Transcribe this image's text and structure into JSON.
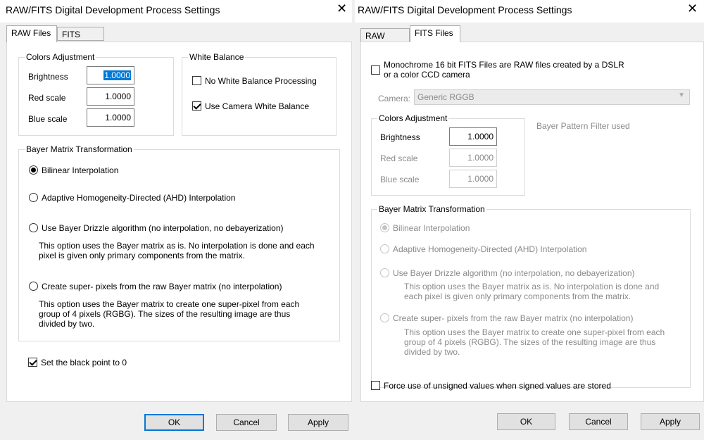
{
  "dialog_title": "RAW/FITS Digital Development Process Settings",
  "close_glyph": "✕",
  "tabs": {
    "raw": "RAW Files",
    "fits": "FITS Files"
  },
  "raw_tab": {
    "colors_adjustment": {
      "title": "Colors Adjustment",
      "brightness_label": "Brightness",
      "brightness_value": "1.0000",
      "red_label": "Red scale",
      "red_value": "1.0000",
      "blue_label": "Blue scale",
      "blue_value": "1.0000"
    },
    "white_balance": {
      "title": "White Balance",
      "no_wb": "No White Balance Processing",
      "no_wb_checked": false,
      "camera_wb": "Use Camera White Balance",
      "camera_wb_checked": true
    },
    "bayer": {
      "title": "Bayer Matrix Transformation",
      "bilinear": "Bilinear Interpolation",
      "ahd": "Adaptive Homogeneity-Directed (AHD) Interpolation",
      "drizzle": "Use Bayer Drizzle algorithm (no interpolation, no debayerization)",
      "drizzle_desc_1": "This option uses the Bayer matrix as is. No interpolation is done and each",
      "drizzle_desc_2": "pixel is given only primary components from the matrix.",
      "superpixel": "Create super- pixels from the raw Bayer matrix (no interpolation)",
      "superpixel_desc_1": "This option uses the Bayer matrix to create one super-pixel from each",
      "superpixel_desc_2": "group of 4 pixels (RGBG). The sizes of the resulting image are thus",
      "superpixel_desc_3": "divided by two.",
      "selected": "bilinear"
    },
    "black_point": {
      "label": "Set the black point to 0",
      "checked": true
    }
  },
  "fits_tab": {
    "monochrome_1": "Monochrome 16 bit FITS Files are RAW files created by a DSLR",
    "monochrome_2": "or a color CCD camera",
    "monochrome_checked": false,
    "camera_label": "Camera:",
    "camera_value": "Generic RGGB",
    "bayer_filter_label": "Bayer Pattern Filter used",
    "colors_adjustment": {
      "title": "Colors Adjustment",
      "brightness_label": "Brightness",
      "brightness_value": "1.0000",
      "red_label": "Red scale",
      "red_value": "1.0000",
      "blue_label": "Blue scale",
      "blue_value": "1.0000"
    },
    "bayer": {
      "title": "Bayer Matrix Transformation",
      "bilinear": "Bilinear Interpolation",
      "ahd": "Adaptive Homogeneity-Directed (AHD) Interpolation",
      "drizzle": "Use Bayer Drizzle algorithm (no interpolation, no debayerization)",
      "drizzle_desc_1": "This option uses the Bayer matrix as is. No interpolation is done and",
      "drizzle_desc_2": "each pixel is given only primary components from the matrix.",
      "superpixel": "Create super- pixels from the raw Bayer matrix (no interpolation)",
      "superpixel_desc_1": "This option uses the Bayer matrix to create one super-pixel from each",
      "superpixel_desc_2": "group of 4 pixels (RGBG). The sizes of the resulting image are thus",
      "superpixel_desc_3": "divided by two.",
      "selected": "bilinear"
    },
    "unsigned": {
      "label": "Force use of unsigned values when signed values are stored",
      "checked": false
    }
  },
  "buttons": {
    "ok": "OK",
    "cancel": "Cancel",
    "apply": "Apply"
  }
}
